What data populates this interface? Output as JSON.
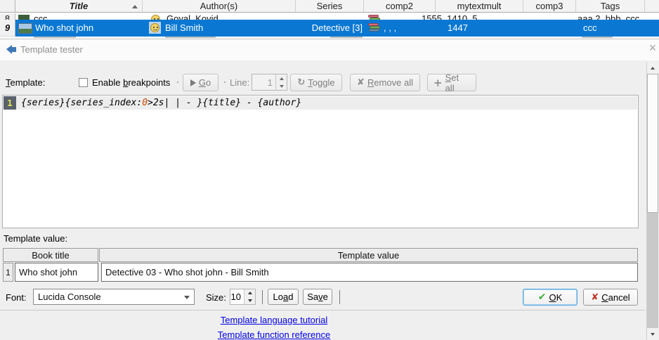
{
  "book_list": {
    "headers": [
      "Title",
      "Author(s)",
      "Series",
      "comp2",
      "mytextmult",
      "comp3",
      "Tags"
    ],
    "partial_row": {
      "num": "8",
      "title": "ccc",
      "authors": "Goyal, Kovid",
      "comp2": ", , ,",
      "mytextmult": "1555, 1410, 5…",
      "tags": "aaa 2, bbb, ccc"
    },
    "selected_row": {
      "num": "9",
      "title": "Who shot john",
      "authors": "Bill Smith",
      "series": "Detective [3]",
      "comp2": ", , ,",
      "mytextmult": "1447",
      "tags": "ccc"
    }
  },
  "dialog": {
    "title": "Template tester",
    "close_glyph": "×",
    "toolbar": {
      "template_label": {
        "pre": "",
        "mn": "T",
        "post": "emplate:"
      },
      "enable_breakpoints": {
        "pre": "Enable ",
        "mn": "b",
        "post": "reakpoints"
      },
      "go": {
        "pre": "",
        "mn": "G",
        "post": "o"
      },
      "line_label": "Line:",
      "line_value": "1",
      "toggle": {
        "pre": "",
        "mn": "T",
        "post": "oggle"
      },
      "toggle_icon_glyph": "↻",
      "remove_all": {
        "pre": "",
        "mn": "R",
        "post": "emove all"
      },
      "remove_icon_glyph": "✘",
      "set_all": {
        "pre": "",
        "mn": "S",
        "post": "et all"
      },
      "set_icon_glyph": "+"
    },
    "editor": {
      "line_number": "1",
      "code_pre": "{series}{series_index:",
      "code_num": "0",
      "code_post": ">2s| | - }{title} - {author}"
    },
    "value_section": {
      "label": "Template value:",
      "headers": [
        "Book title",
        "Template value"
      ],
      "row": {
        "num": "1",
        "book_title": "Who shot john",
        "value": "Detective 03 - Who shot john - Bill Smith"
      }
    },
    "footer": {
      "font_label": "Font:",
      "font_value": "Lucida Console",
      "size_label": "Size:",
      "size_value": "10",
      "load": {
        "pre": "Lo",
        "mn": "a",
        "post": "d"
      },
      "save": {
        "pre": "Sa",
        "mn": "v",
        "post": "e"
      },
      "ok": {
        "pre": "",
        "mn": "O",
        "post": "K"
      },
      "ok_icon_glyph": "✔",
      "cancel": {
        "pre": "",
        "mn": "C",
        "post": "ancel"
      },
      "cancel_icon_glyph": "✘"
    },
    "links": [
      "Template language tutorial",
      "Template function reference"
    ]
  },
  "colors": {
    "selection_blue": "#0a78d2",
    "link_blue": "#0000e6",
    "code_number": "#cc4a00",
    "gutter_bg": "#5a626c",
    "gutter_fg": "#e8e850",
    "ok_check_green": "#3fae3f",
    "cancel_x_red": "#c0332b"
  }
}
